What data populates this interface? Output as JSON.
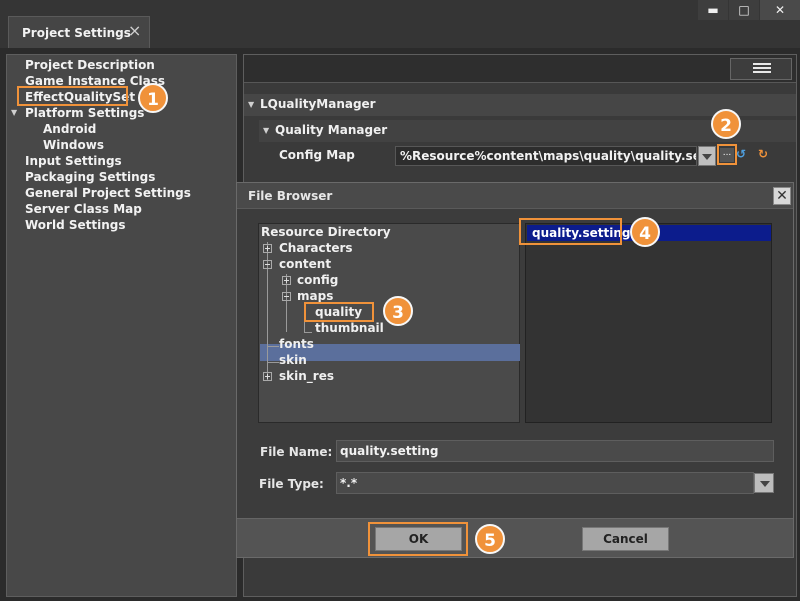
{
  "tab": {
    "title": "Project Settings",
    "close_icon": "×"
  },
  "window_controls": {
    "minimize": "▬",
    "maximize": "□",
    "close": "✕"
  },
  "sidebar": {
    "items": [
      {
        "label": "Project Description"
      },
      {
        "label": "Game Instance Class"
      },
      {
        "label": "EffectQualitySet"
      },
      {
        "label": "Platform Settings",
        "expanded": true
      },
      {
        "label": "Android"
      },
      {
        "label": "Windows"
      },
      {
        "label": "Input Settings"
      },
      {
        "label": "Packaging Settings"
      },
      {
        "label": "General Project Settings"
      },
      {
        "label": "Server Class Map"
      },
      {
        "label": "World Settings"
      }
    ]
  },
  "details": {
    "section_title": "LQualityManager",
    "subsection_title": "Quality Manager",
    "property_label": "Config Map",
    "property_value": "%Resource%content\\maps\\quality\\quality.setting",
    "browse_label": "...",
    "icons": [
      "chevron-down-icon",
      "browse-icon",
      "reset-icon",
      "revert-icon"
    ]
  },
  "dialog": {
    "title": "File Browser",
    "close_label": "✕",
    "tree": [
      {
        "label": "Resource Directory"
      },
      {
        "label": "Characters"
      },
      {
        "label": "content"
      },
      {
        "label": "config"
      },
      {
        "label": "maps"
      },
      {
        "label": "quality"
      },
      {
        "label": "thumbnail"
      },
      {
        "label": "fonts"
      },
      {
        "label": "skin"
      },
      {
        "label": "skin_res"
      }
    ],
    "files": [
      {
        "label": "quality.setting"
      }
    ],
    "file_name_label": "File Name:",
    "file_name_value": "quality.setting",
    "file_type_label": "File Type:",
    "file_type_value": "*.*",
    "ok_label": "OK",
    "cancel_label": "Cancel"
  },
  "callouts": [
    "1",
    "2",
    "3",
    "4",
    "5"
  ],
  "colors": {
    "accent": "#f0923a",
    "selection_blue": "#0c1c8c",
    "tree_selection": "#5b6f9c"
  }
}
